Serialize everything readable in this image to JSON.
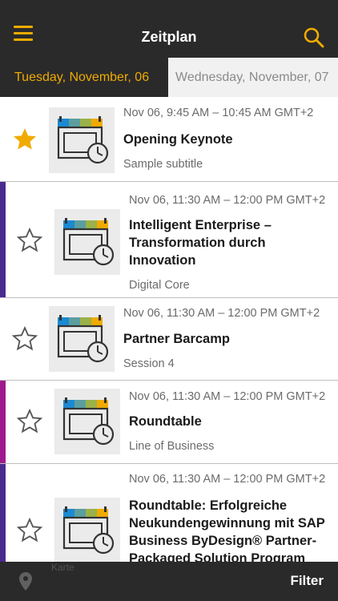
{
  "header": {
    "title": "Zeitplan",
    "menu_icon": "hamburger-menu-icon",
    "search_icon": "search-icon",
    "accent_color": "#f0ab00",
    "bar_color": "#2a2a2a"
  },
  "day_tabs": [
    {
      "label": "Tuesday, November, 06",
      "selected": true
    },
    {
      "label": "Wednesday, November, 07",
      "selected": false
    }
  ],
  "sessions": [
    {
      "time": "Nov 06, 9:45 AM – 10:45 AM GMT+2",
      "title": "Opening Keynote",
      "subtitle": "Sample subtitle",
      "favorited": true,
      "track_color": ""
    },
    {
      "time": "Nov 06, 11:30 AM – 12:00 PM GMT+2",
      "title": "Intelligent Enterprise – Transformation durch Innovation",
      "subtitle": "Digital Core",
      "favorited": false,
      "track_color": "#4a2a8c"
    },
    {
      "time": "Nov 06, 11:30 AM – 12:00 PM GMT+2",
      "title": "Partner Barcamp",
      "subtitle": "Session 4",
      "favorited": false,
      "track_color": ""
    },
    {
      "time": "Nov 06, 11:30 AM – 12:00 PM GMT+2",
      "title": "Roundtable",
      "subtitle": "Line of Business",
      "favorited": false,
      "track_color": "#a0198c"
    },
    {
      "time": "Nov 06, 11:30 AM – 12:00 PM GMT+2",
      "title": "Roundtable: Erfolgreiche Neukundengewinnung mit SAP Business ByDesign® Partner-Packaged Solution Program",
      "subtitle": "",
      "favorited": false,
      "track_color": "#4a2a8c"
    }
  ],
  "bottom_bar": {
    "map_icon": "map-pin-icon",
    "map_label": "Karte",
    "filter_label": "Filter"
  }
}
